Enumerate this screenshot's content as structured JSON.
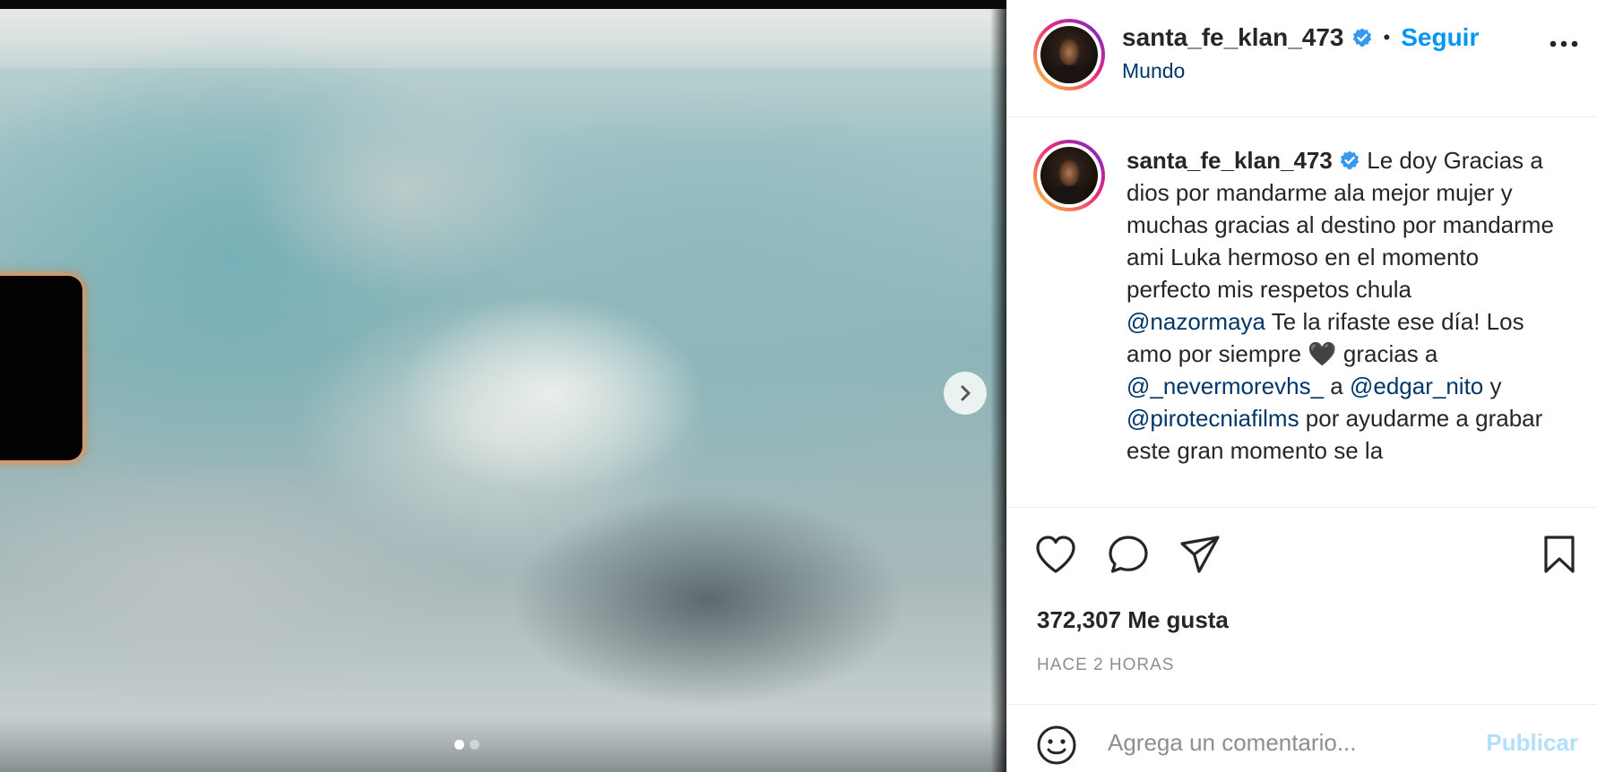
{
  "media": {
    "image_alt": "",
    "carousel": {
      "total": 2,
      "active": 0
    },
    "next_icon": "chevron-right-icon"
  },
  "header": {
    "username": "santa_fe_klan_473",
    "verified_icon": "verified-badge-icon",
    "separator": "•",
    "follow_label": "Seguir",
    "location": "Mundo",
    "more_icon": "more-horizontal-icon"
  },
  "caption": {
    "username": "santa_fe_klan_473",
    "part1": " Le doy Gracias a dios por mandarme ala mejor mujer y muchas gracias al destino por mandarme ami Luka hermoso en el momento perfecto mis respetos chula ",
    "mention1": "@nazormaya",
    "part2": " Te la rifaste ese día! Los amo por siempre 🖤 gracias a ",
    "mention2": "@_nevermorevhs_",
    "part3": " a ",
    "mention3": "@edgar_nito",
    "part4": " y ",
    "mention4": "@pirotecniafilms",
    "part5": " por ayudarme a grabar este gran momento se la"
  },
  "actions": {
    "like_icon": "heart-icon",
    "comment_icon": "comment-icon",
    "share_icon": "paper-plane-icon",
    "save_icon": "bookmark-icon",
    "likes_text": "372,307 Me gusta",
    "time_text": "HACE 2 HORAS"
  },
  "comment": {
    "emoji_icon": "emoji-icon",
    "placeholder": "Agrega un comentario...",
    "publish_label": "Publicar"
  },
  "colors": {
    "accent": "#0095f6",
    "mention": "#00376b",
    "publish_disabled": "#b2dffc",
    "muted": "#8e8e8e",
    "text": "#262626"
  }
}
